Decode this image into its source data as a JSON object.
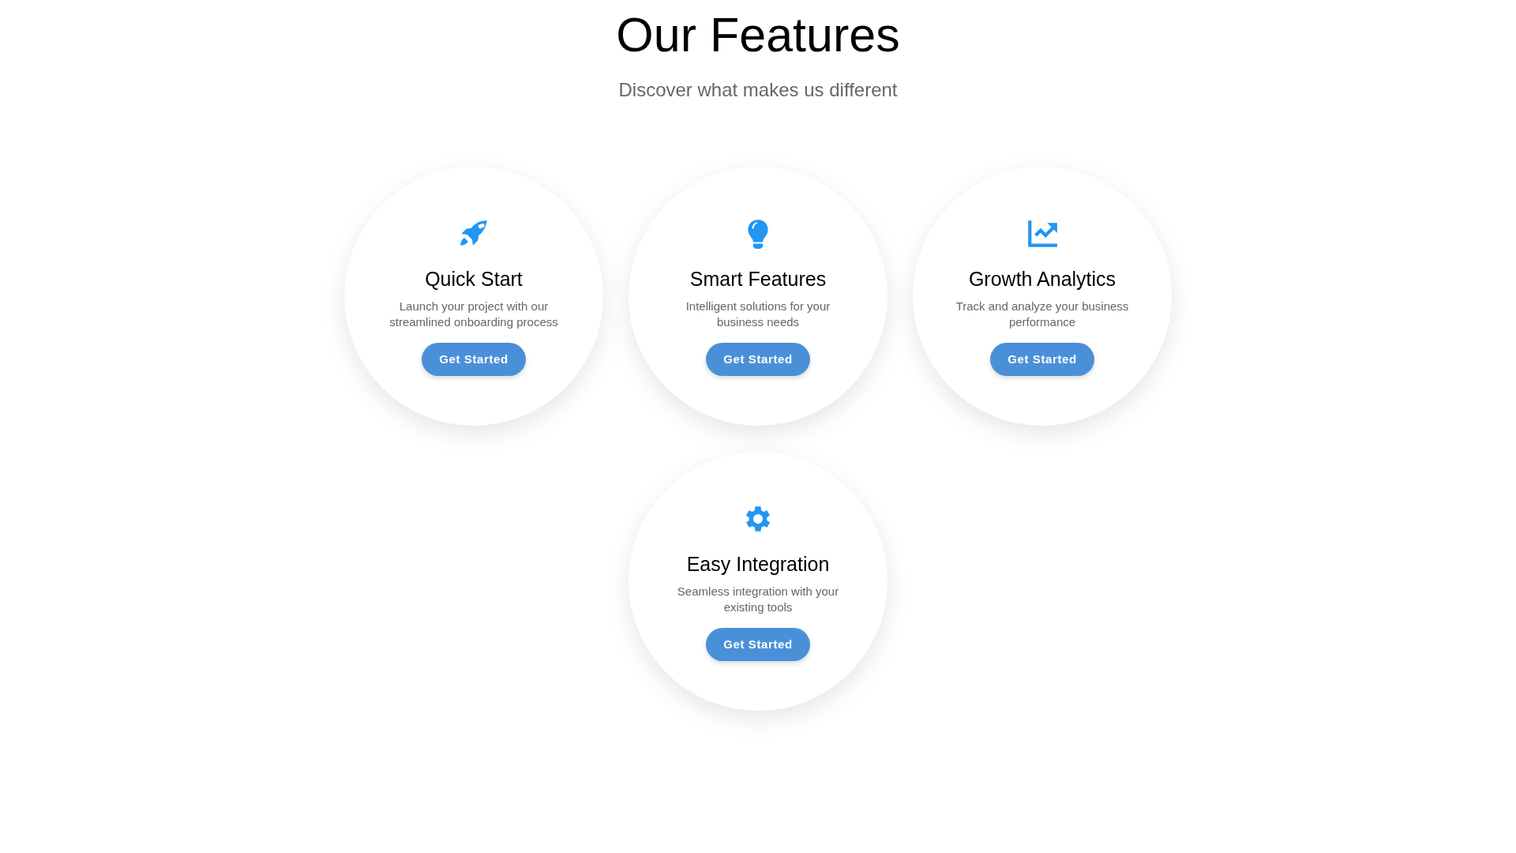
{
  "header": {
    "title": "Our Features",
    "subtitle": "Discover what makes us different"
  },
  "features": [
    {
      "title": "Quick Start",
      "description": "Launch your project with our streamlined onboarding process",
      "button": "Get Started"
    },
    {
      "title": "Smart Features",
      "description": "Intelligent solutions for your business needs",
      "button": "Get Started"
    },
    {
      "title": "Growth Analytics",
      "description": "Track and analyze your business performance",
      "button": "Get Started"
    },
    {
      "title": "Easy Integration",
      "description": "Seamless integration with your existing tools",
      "button": "Get Started"
    }
  ]
}
